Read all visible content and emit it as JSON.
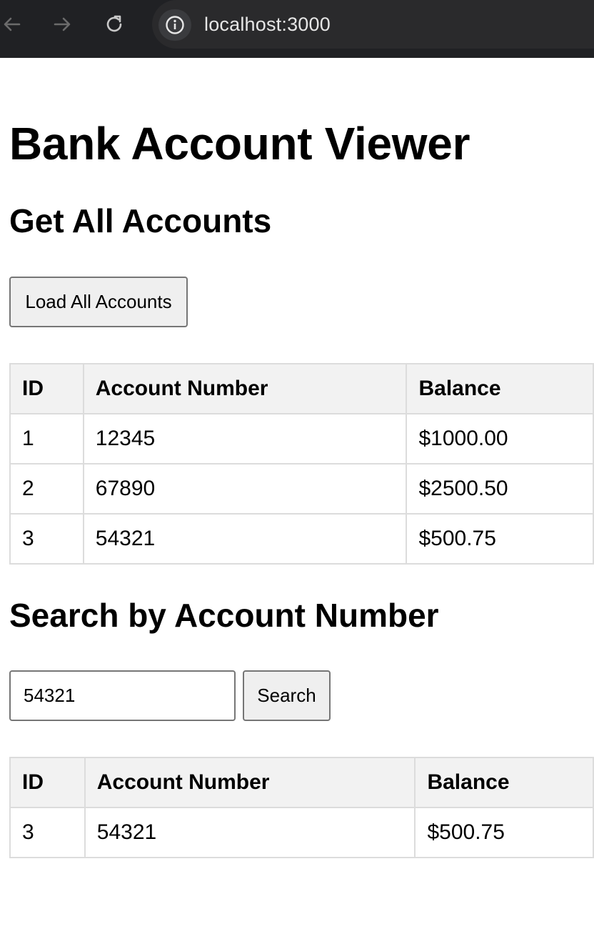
{
  "browser": {
    "url": "localhost:3000"
  },
  "page": {
    "title": "Bank Account Viewer",
    "all_accounts": {
      "heading": "Get All Accounts",
      "load_button_label": "Load All Accounts",
      "columns": [
        "ID",
        "Account Number",
        "Balance"
      ],
      "rows": [
        [
          "1",
          "12345",
          "$1000.00"
        ],
        [
          "2",
          "67890",
          "$2500.50"
        ],
        [
          "3",
          "54321",
          "$500.75"
        ]
      ]
    },
    "search": {
      "heading": "Search by Account Number",
      "input_value": "54321",
      "button_label": "Search",
      "columns": [
        "ID",
        "Account Number",
        "Balance"
      ],
      "rows": [
        [
          "3",
          "54321",
          "$500.75"
        ]
      ]
    }
  }
}
